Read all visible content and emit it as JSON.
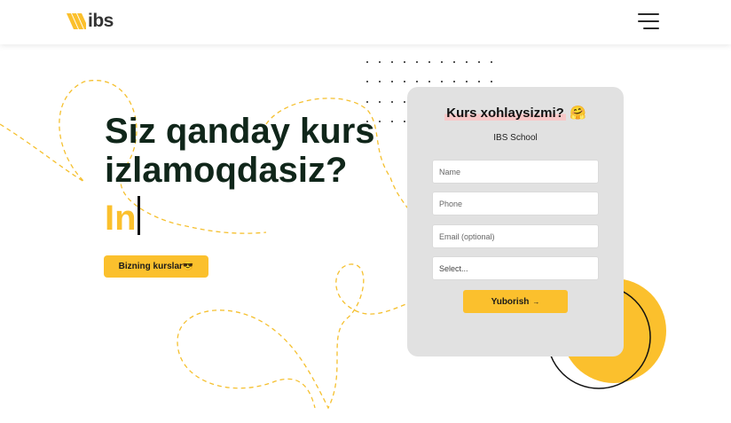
{
  "header": {
    "logo_text": "ibs",
    "menu_icon": "hamburger-menu-icon"
  },
  "hero": {
    "title": "Siz qanday kurs izlamoqdasiz?",
    "typed_text": "In",
    "button_label": "Bizning kurslar😎"
  },
  "form": {
    "title": "Kurs xohlaysizmi?",
    "title_emoji": "🤗",
    "subtitle": "IBS School",
    "name_placeholder": "Name",
    "phone_placeholder": "Phone",
    "email_placeholder": "Email (optional)",
    "select_value": "Select...",
    "submit_label": "Yuborish",
    "submit_arrow": "→"
  },
  "colors": {
    "accent": "#fbc02d",
    "heading": "#10261a",
    "card_bg": "#e1e1e1",
    "title_highlight": "#f7c8c8"
  }
}
